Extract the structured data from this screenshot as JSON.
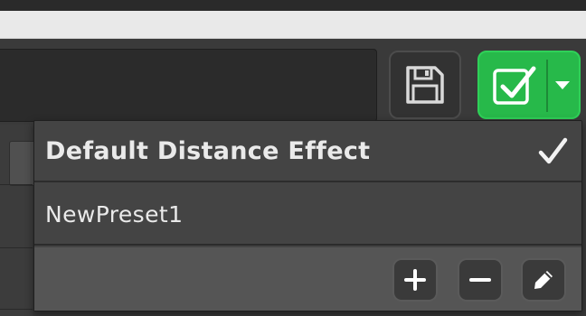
{
  "presets": {
    "items": [
      {
        "label": "Default Distance Effect",
        "selected": true
      },
      {
        "label": "NewPreset1",
        "selected": false
      }
    ],
    "actions": {
      "add_icon": "plus-icon",
      "remove_icon": "minus-icon",
      "edit_icon": "pencil-icon"
    }
  },
  "toolbar": {
    "save_icon": "floppy-disk-icon",
    "apply_icon": "checkbox-check-icon",
    "apply_dropdown_icon": "caret-down-icon"
  },
  "colors": {
    "apply_green": "#27b94a",
    "menu_bg": "#444444",
    "footer_bg": "#555555",
    "text": "#eaeaea"
  }
}
